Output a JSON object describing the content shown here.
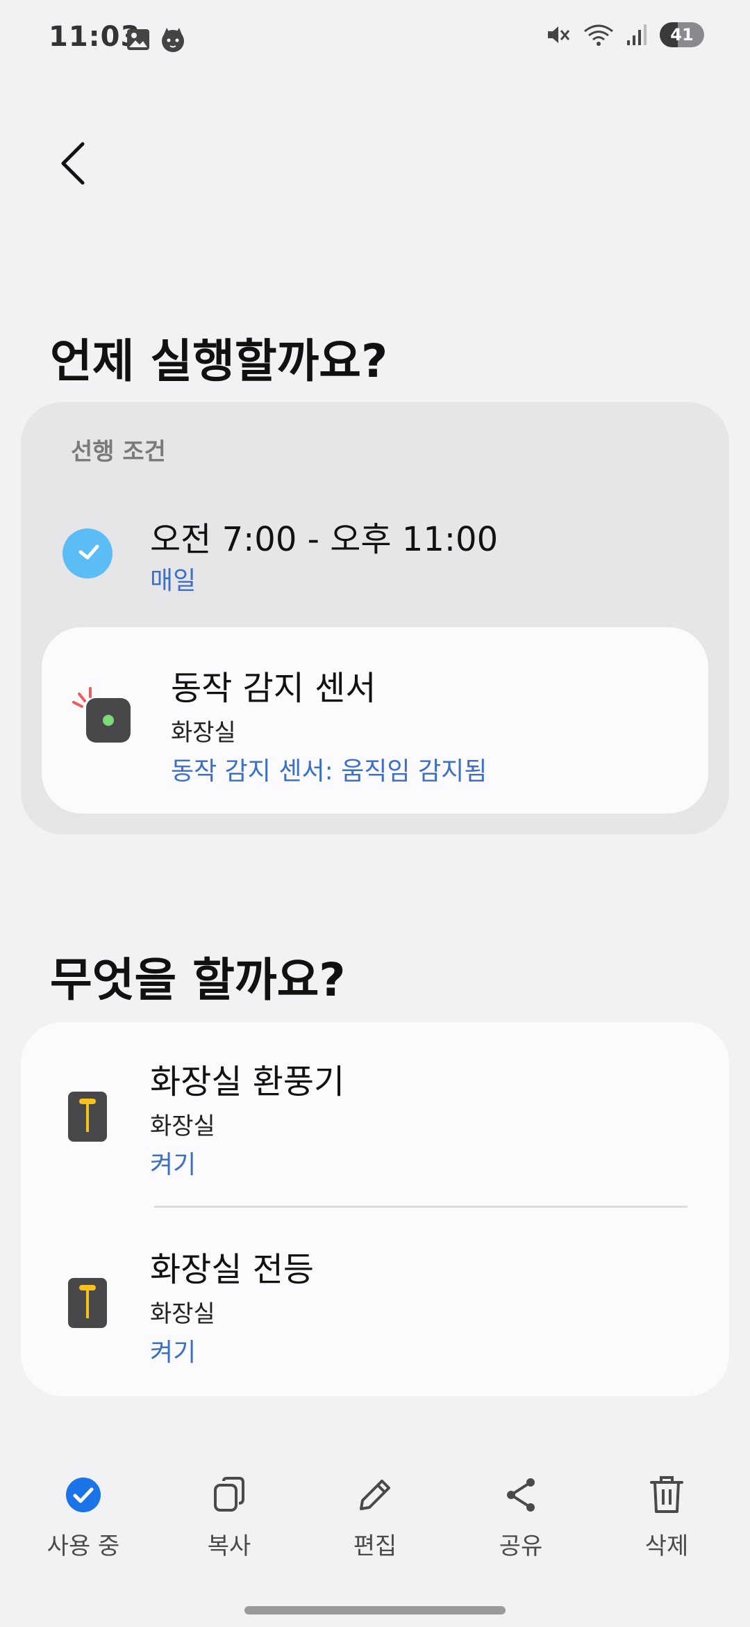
{
  "status_bar": {
    "time": "11:03",
    "battery": "41"
  },
  "when": {
    "title": "언제 실행할까요?",
    "precondition_label": "선행 조건",
    "time_range": "오전 7:00 - 오후 11:00",
    "repeat": "매일",
    "sensor": {
      "name": "동작 감지 센서",
      "room": "화장실",
      "state": "동작 감지 센서: 움직임 감지됨"
    }
  },
  "what": {
    "title": "무엇을 할까요?",
    "actions": [
      {
        "name": "화장실 환풍기",
        "room": "화장실",
        "action": "켜기"
      },
      {
        "name": "화장실 전등",
        "room": "화장실",
        "action": "켜기"
      }
    ]
  },
  "bottom_bar": {
    "items": [
      {
        "label": "사용 중",
        "icon": "check-circle-icon"
      },
      {
        "label": "복사",
        "icon": "copy-icon"
      },
      {
        "label": "편집",
        "icon": "pencil-icon"
      },
      {
        "label": "공유",
        "icon": "share-icon"
      },
      {
        "label": "삭제",
        "icon": "trash-icon"
      }
    ]
  },
  "colors": {
    "accent": "#3b6fc9",
    "background": "#f2f2f4",
    "active_check": "#1a73e8",
    "clock": "#5cbdf5"
  }
}
